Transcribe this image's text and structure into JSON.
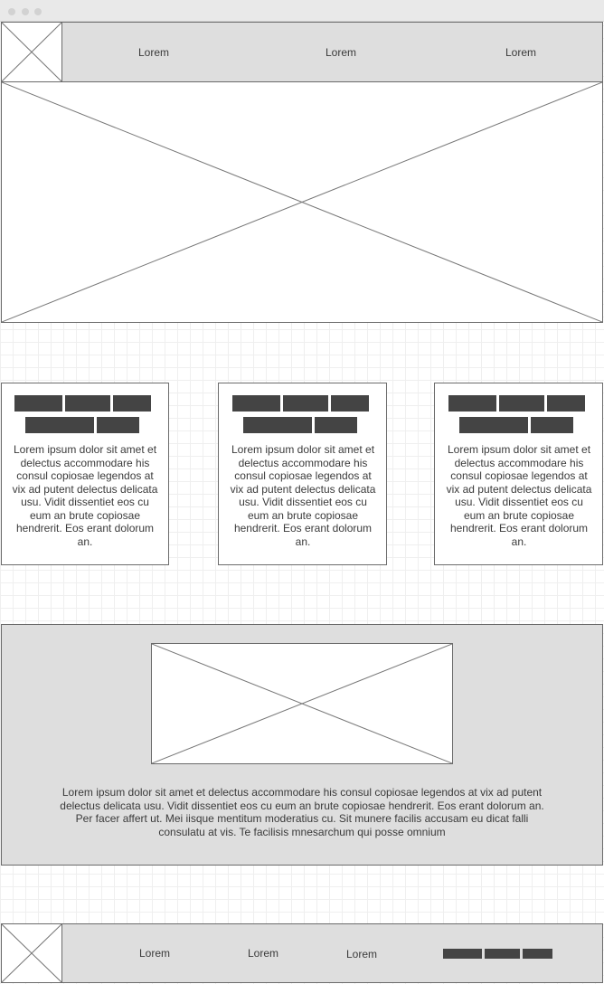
{
  "header": {
    "nav": [
      "Lorem",
      "Lorem",
      "Lorem"
    ]
  },
  "cards": [
    {
      "text": "Lorem ipsum dolor sit amet et delectus accommodare his consul copiosae legendos at vix ad putent delectus delicata usu. Vidit dissentiet eos cu eum an brute copiosae hendrerit. Eos erant dolorum an."
    },
    {
      "text": "Lorem ipsum dolor sit amet et delectus accommodare his consul copiosae legendos at vix ad putent delectus delicata usu. Vidit dissentiet eos cu eum an brute copiosae hendrerit. Eos erant dolorum an."
    },
    {
      "text": "Lorem ipsum dolor sit amet et delectus accommodare his consul copiosae legendos at vix ad putent delectus delicata usu. Vidit dissentiet eos cu eum an brute copiosae hendrerit. Eos erant dolorum an."
    }
  ],
  "feature": {
    "text": "Lorem ipsum dolor sit amet et delectus accommodare his consul copiosae legendos at vix ad putent delectus delicata usu. Vidit dissentiet eos cu eum an brute copiosae hendrerit. Eos erant dolorum an. Per facer affert ut. Mei iisque mentitum moderatius cu. Sit munere facilis accusam eu dicat falli consulatu at vis. Te facilisis mnesarchum qui posse omnium"
  },
  "footer": {
    "nav": [
      "Lorem",
      "Lorem",
      "Lorem"
    ]
  },
  "colors": {
    "panel_grey": "#dedede",
    "bar_dark": "#444444",
    "border": "#6b6b6b"
  },
  "icons": {
    "logo": "image-placeholder-icon",
    "hero": "image-placeholder-icon"
  }
}
